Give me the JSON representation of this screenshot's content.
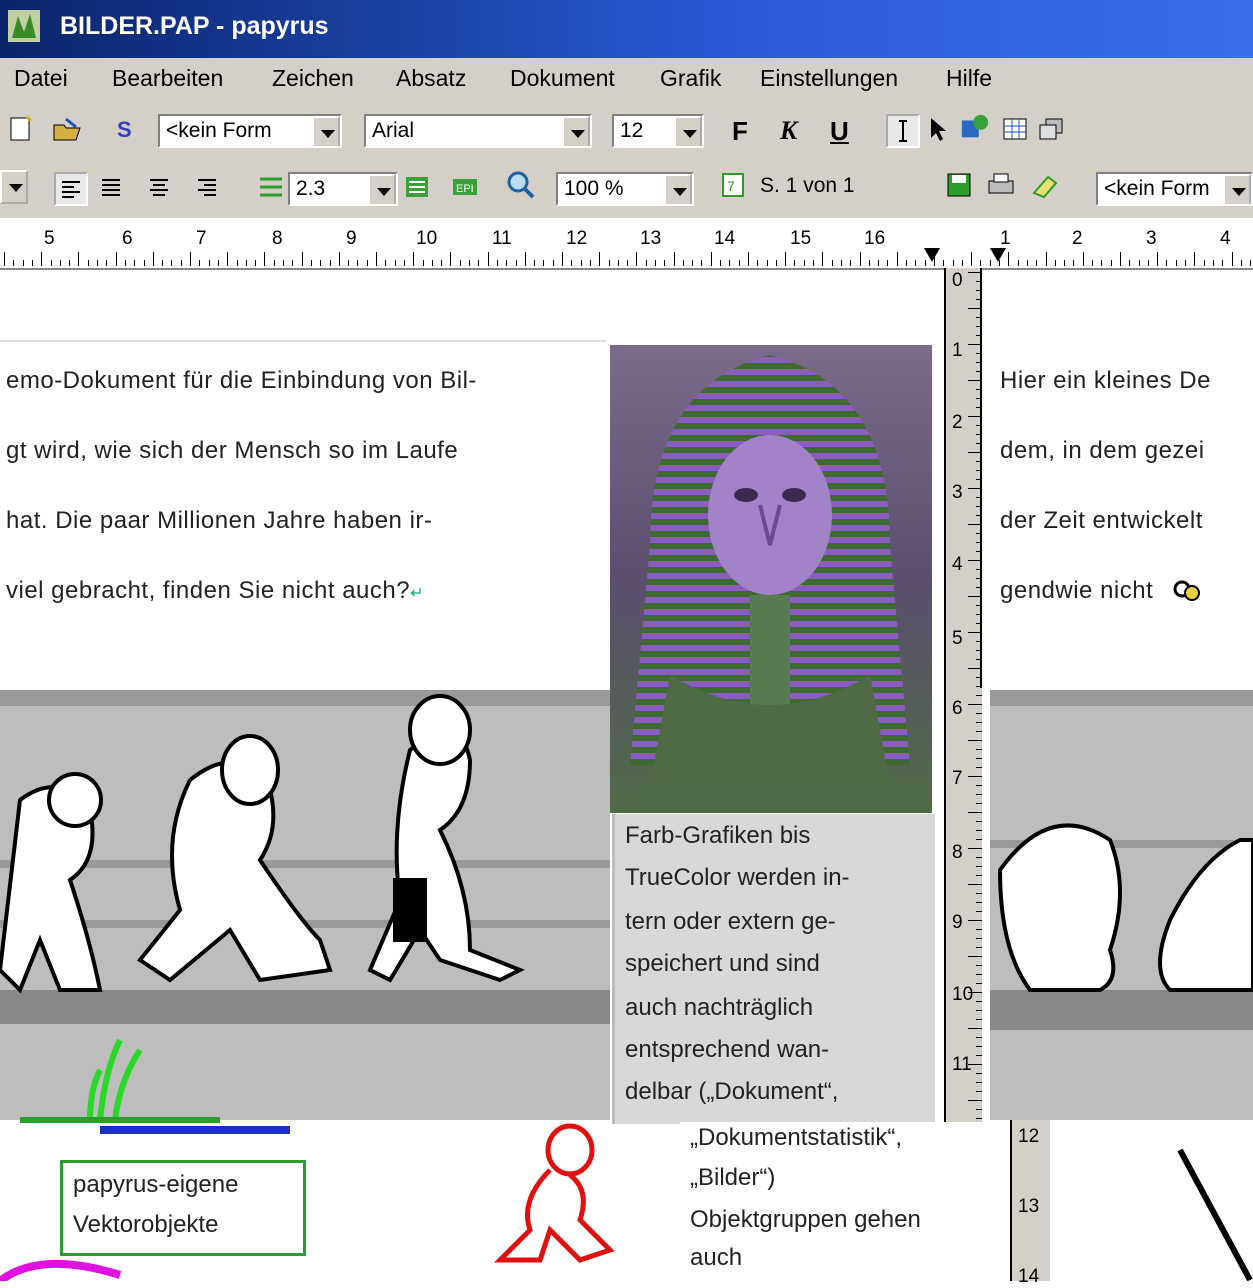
{
  "window": {
    "title": "BILDER.PAP - papyrus"
  },
  "menu": [
    "Datei",
    "Bearbeiten",
    "Zeichen",
    "Absatz",
    "Dokument",
    "Grafik",
    "Einstellungen",
    "Hilfe"
  ],
  "toolbar1": {
    "style_select": "<kein Form",
    "font_select": "Arial",
    "size_select": "12",
    "bold_label": "F",
    "italic_label": "K",
    "underline_label": "U"
  },
  "toolbar2": {
    "line_spacing": "2.3",
    "zoom": "100 %",
    "page_status": "S. 1 von 1",
    "style_select2": "<kein Form"
  },
  "ruler": {
    "labels": [
      "5",
      "6",
      "7",
      "8",
      "9",
      "10",
      "11",
      "12",
      "13",
      "14",
      "15",
      "16",
      "1",
      "2",
      "3",
      "4"
    ]
  },
  "vruler": {
    "labels": [
      "0",
      "1",
      "2",
      "3",
      "4",
      "5",
      "6",
      "7",
      "8",
      "9",
      "10",
      "11"
    ],
    "labels2": [
      "12",
      "13",
      "14"
    ]
  },
  "document": {
    "left_lines": [
      "emo-Dokument für die Einbindung von Bil-",
      "gt wird, wie sich der Mensch so im Laufe",
      "hat. Die paar Millionen Jahre haben ir-",
      "viel gebracht,  finden Sie nicht auch?"
    ],
    "right_lines": [
      "Hier ein kleines De",
      "dem, in dem gezei",
      "der Zeit entwickelt",
      "gendwie nicht"
    ],
    "caption_lines": [
      "Farb-Grafiken bis",
      "TrueColor werden in-",
      "tern oder extern ge-",
      "speichert und sind",
      "auch nachträglich",
      "entsprechend wan-",
      "delbar („Dokument“,"
    ],
    "caption2_lines": [
      "„Dokumentstatistik“,",
      "„Bilder“)",
      "Objektgruppen gehen",
      "auch"
    ],
    "vector_lines": [
      "papyrus-eigene",
      "Vektorobjekte"
    ]
  }
}
